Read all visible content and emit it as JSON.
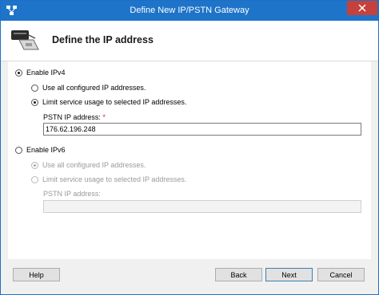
{
  "window": {
    "title": "Define New IP/PSTN Gateway"
  },
  "header": {
    "title": "Define the IP address"
  },
  "ipv4": {
    "enable_label": "Enable IPv4",
    "enabled": true,
    "option_all": "Use all configured IP addresses.",
    "option_limit": "Limit service usage to selected IP addresses.",
    "selected_option": "limit",
    "pstn_label": "PSTN IP address:",
    "required_marker": "*",
    "pstn_value": "176.62.196.248"
  },
  "ipv6": {
    "enable_label": "Enable IPv6",
    "enabled": false,
    "option_all": "Use all configured IP addresses.",
    "option_limit": "Limit service usage to selected IP addresses.",
    "selected_option": "all",
    "pstn_label": "PSTN IP address:",
    "pstn_value": ""
  },
  "footer": {
    "help_label": "Help",
    "back_label": "Back",
    "next_label": "Next",
    "cancel_label": "Cancel"
  },
  "colors": {
    "titlebar": "#1e74c9",
    "close_button": "#c7413c",
    "required": "#d2232a"
  }
}
